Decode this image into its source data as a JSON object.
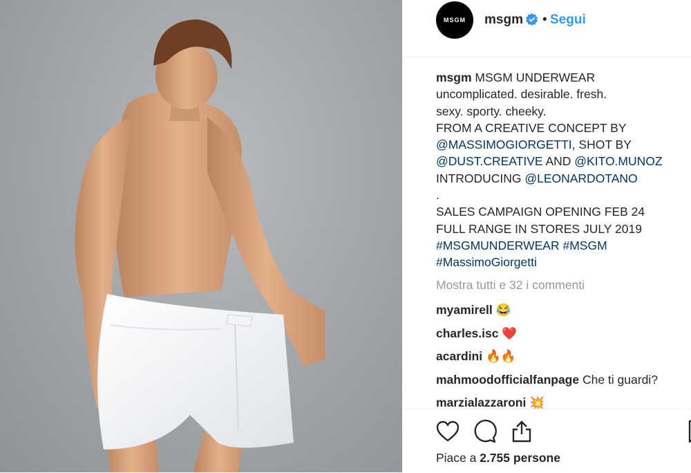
{
  "post": {
    "account": {
      "username": "msgm",
      "avatar_text": "MSGM",
      "verified": true,
      "separator": "•",
      "follow_label": "Segui"
    },
    "caption": {
      "username": "msgm",
      "lines": [
        [
          {
            "t": "MSGM UNDERWEAR",
            "m": false
          }
        ],
        [
          {
            "t": "uncomplicated. desirable. fresh.",
            "m": false
          }
        ],
        [
          {
            "t": "sexy. sporty. cheeky.",
            "m": false
          }
        ],
        [
          {
            "t": "FROM A CREATIVE CONCEPT BY",
            "m": false
          }
        ],
        [
          {
            "t": "@MASSIMOGIORGETTI",
            "m": true
          },
          {
            "t": ", SHOT BY",
            "m": false
          }
        ],
        [
          {
            "t": "@DUST.CREATIVE",
            "m": true
          },
          {
            "t": " AND ",
            "m": false
          },
          {
            "t": "@KITO.MUNOZ",
            "m": true
          }
        ],
        [
          {
            "t": "INTRODUCING ",
            "m": false
          },
          {
            "t": "@LEONARDOTANO",
            "m": true
          }
        ],
        [
          {
            "t": ".",
            "m": false
          }
        ],
        [
          {
            "t": "SALES CAMPAIGN OPENING FEB 24",
            "m": false
          }
        ],
        [
          {
            "t": "FULL RANGE IN STORES JULY 2019",
            "m": false
          }
        ],
        [
          {
            "t": "#MSGMUNDERWEAR",
            "m": true
          },
          {
            "t": " ",
            "m": false
          },
          {
            "t": "#MSGM",
            "m": true
          }
        ],
        [
          {
            "t": "#MassimoGiorgetti",
            "m": true
          }
        ]
      ]
    },
    "view_all_comments": "Mostra tutti e 32 i commenti",
    "comments": [
      {
        "user": "myamirell",
        "text": "😂"
      },
      {
        "user": "charles.isc",
        "text": "❤️"
      },
      {
        "user": "acardini",
        "text": "🔥🔥"
      },
      {
        "user": "mahmoodofficialfanpage",
        "text": "Che ti guardi?"
      },
      {
        "user": "marzialazzaroni",
        "text": "💥"
      }
    ],
    "actions": {
      "like_icon": "heart-icon",
      "comment_icon": "comment-icon",
      "share_icon": "share-icon",
      "save_icon": "bookmark-icon"
    },
    "likes": {
      "prefix": "Piace a ",
      "count": "2.755",
      "suffix": " persone"
    },
    "colors": {
      "link": "#3897f0",
      "mention": "#003569",
      "muted": "#999999",
      "text": "#262626",
      "verified": "#3897f0"
    }
  }
}
